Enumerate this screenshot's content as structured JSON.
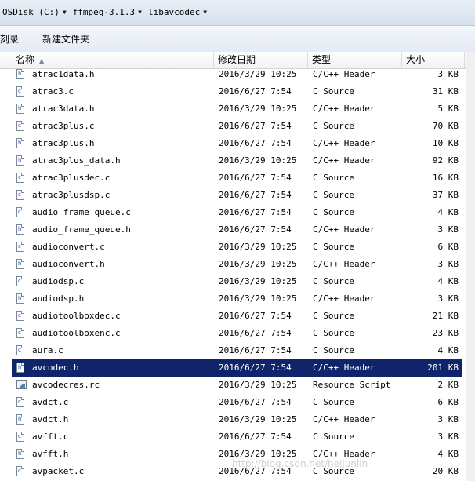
{
  "breadcrumb": [
    "OSDisk (C:)",
    "ffmpeg-3.1.3",
    "libavcodec"
  ],
  "toolbar": {
    "burn": "刻录",
    "new_folder": "新建文件夹"
  },
  "columns": {
    "name": "名称",
    "date": "修改日期",
    "type": "类型",
    "size": "大小"
  },
  "selected_index": 17,
  "files": [
    {
      "name": "atrac1data.h",
      "date": "2016/3/29 10:25",
      "type": "C/C++ Header",
      "size": "3 KB",
      "icon": "header-file-icon"
    },
    {
      "name": "atrac3.c",
      "date": "2016/6/27 7:54",
      "type": "C Source",
      "size": "31 KB",
      "icon": "c-source-file-icon"
    },
    {
      "name": "atrac3data.h",
      "date": "2016/3/29 10:25",
      "type": "C/C++ Header",
      "size": "5 KB",
      "icon": "header-file-icon"
    },
    {
      "name": "atrac3plus.c",
      "date": "2016/6/27 7:54",
      "type": "C Source",
      "size": "70 KB",
      "icon": "c-source-file-icon"
    },
    {
      "name": "atrac3plus.h",
      "date": "2016/6/27 7:54",
      "type": "C/C++ Header",
      "size": "10 KB",
      "icon": "header-file-icon"
    },
    {
      "name": "atrac3plus_data.h",
      "date": "2016/3/29 10:25",
      "type": "C/C++ Header",
      "size": "92 KB",
      "icon": "header-file-icon"
    },
    {
      "name": "atrac3plusdec.c",
      "date": "2016/6/27 7:54",
      "type": "C Source",
      "size": "16 KB",
      "icon": "c-source-file-icon"
    },
    {
      "name": "atrac3plusdsp.c",
      "date": "2016/6/27 7:54",
      "type": "C Source",
      "size": "37 KB",
      "icon": "c-source-file-icon"
    },
    {
      "name": "audio_frame_queue.c",
      "date": "2016/6/27 7:54",
      "type": "C Source",
      "size": "4 KB",
      "icon": "c-source-file-icon"
    },
    {
      "name": "audio_frame_queue.h",
      "date": "2016/6/27 7:54",
      "type": "C/C++ Header",
      "size": "3 KB",
      "icon": "header-file-icon"
    },
    {
      "name": "audioconvert.c",
      "date": "2016/3/29 10:25",
      "type": "C Source",
      "size": "6 KB",
      "icon": "c-source-file-icon"
    },
    {
      "name": "audioconvert.h",
      "date": "2016/3/29 10:25",
      "type": "C/C++ Header",
      "size": "3 KB",
      "icon": "header-file-icon"
    },
    {
      "name": "audiodsp.c",
      "date": "2016/3/29 10:25",
      "type": "C Source",
      "size": "4 KB",
      "icon": "c-source-file-icon"
    },
    {
      "name": "audiodsp.h",
      "date": "2016/3/29 10:25",
      "type": "C/C++ Header",
      "size": "3 KB",
      "icon": "header-file-icon"
    },
    {
      "name": "audiotoolboxdec.c",
      "date": "2016/6/27 7:54",
      "type": "C Source",
      "size": "21 KB",
      "icon": "c-source-file-icon"
    },
    {
      "name": "audiotoolboxenc.c",
      "date": "2016/6/27 7:54",
      "type": "C Source",
      "size": "23 KB",
      "icon": "c-source-file-icon"
    },
    {
      "name": "aura.c",
      "date": "2016/6/27 7:54",
      "type": "C Source",
      "size": "4 KB",
      "icon": "c-source-file-icon"
    },
    {
      "name": "avcodec.h",
      "date": "2016/6/27 7:54",
      "type": "C/C++ Header",
      "size": "201 KB",
      "icon": "header-file-icon"
    },
    {
      "name": "avcodecres.rc",
      "date": "2016/3/29 10:25",
      "type": "Resource Script",
      "size": "2 KB",
      "icon": "resource-script-icon"
    },
    {
      "name": "avdct.c",
      "date": "2016/6/27 7:54",
      "type": "C Source",
      "size": "6 KB",
      "icon": "c-source-file-icon"
    },
    {
      "name": "avdct.h",
      "date": "2016/3/29 10:25",
      "type": "C/C++ Header",
      "size": "3 KB",
      "icon": "header-file-icon"
    },
    {
      "name": "avfft.c",
      "date": "2016/6/27 7:54",
      "type": "C Source",
      "size": "3 KB",
      "icon": "c-source-file-icon"
    },
    {
      "name": "avfft.h",
      "date": "2016/3/29 10:25",
      "type": "C/C++ Header",
      "size": "4 KB",
      "icon": "header-file-icon"
    },
    {
      "name": "avpacket.c",
      "date": "2016/6/27 7:54",
      "type": "C Source",
      "size": "20 KB",
      "icon": "c-source-file-icon"
    }
  ],
  "watermark": "http://blog.csdn.net/hejjunlin",
  "colors": {
    "selection": "#10246b",
    "selection_text": "#ffffff"
  }
}
